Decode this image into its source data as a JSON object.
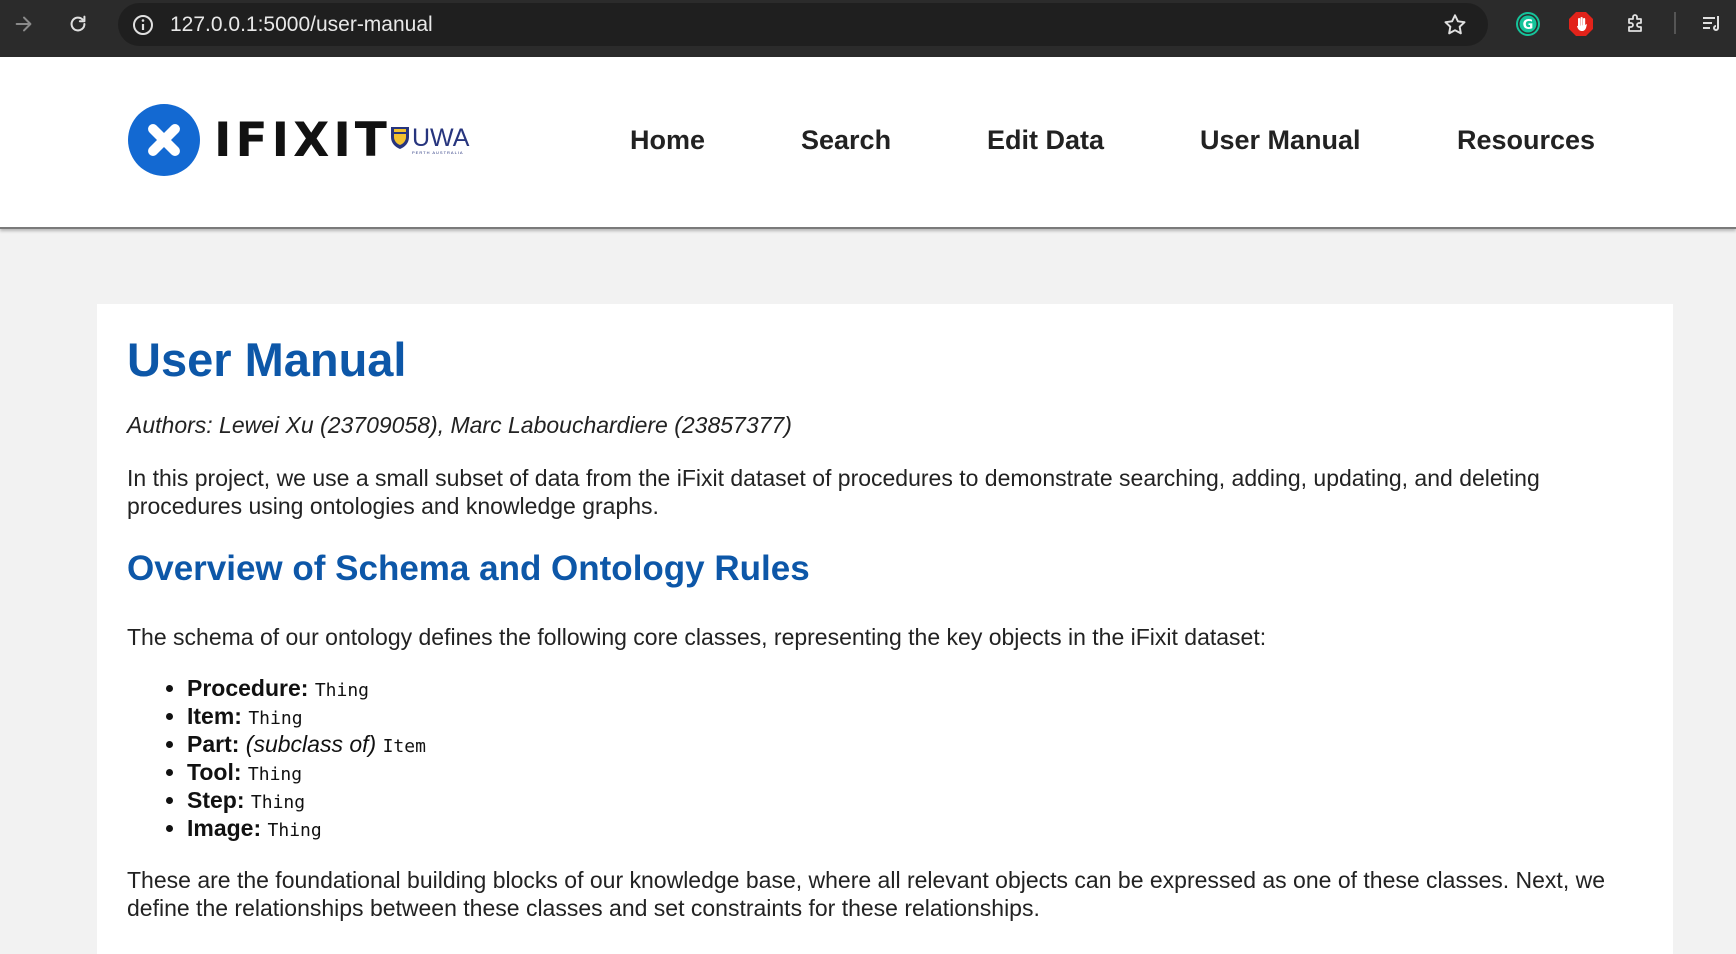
{
  "browser": {
    "url": "127.0.0.1:5000/user-manual"
  },
  "header": {
    "logo_text": "IFIXIT",
    "partner_logo_text": "UWA",
    "partner_logo_subtext": "PERTH AUSTRALIA",
    "nav": [
      {
        "label": "Home"
      },
      {
        "label": "Search"
      },
      {
        "label": "Edit Data"
      },
      {
        "label": "User Manual"
      },
      {
        "label": "Resources"
      }
    ]
  },
  "main": {
    "title": "User Manual",
    "authors": "Authors: Lewei Xu (23709058), Marc Labouchardiere (23857377)",
    "intro": "In this project, we use a small subset of data from the iFixit dataset of procedures to demonstrate searching, adding, updating, and deleting procedures using ontologies and knowledge graphs.",
    "section_title": "Overview of Schema and Ontology Rules",
    "schema_intro": "The schema of our ontology defines the following core classes, representing the key objects in the iFixit dataset:",
    "classes": [
      {
        "name": "Procedure:",
        "qualifier": "",
        "parent": "Thing"
      },
      {
        "name": "Item:",
        "qualifier": "",
        "parent": "Thing"
      },
      {
        "name": "Part:",
        "qualifier": "(subclass of)",
        "parent": "Item"
      },
      {
        "name": "Tool:",
        "qualifier": "",
        "parent": "Thing"
      },
      {
        "name": "Step:",
        "qualifier": "",
        "parent": "Thing"
      },
      {
        "name": "Image:",
        "qualifier": "",
        "parent": "Thing"
      }
    ],
    "outro": "These are the foundational building blocks of our knowledge base, where all relevant objects can be expressed as one of these classes. Next, we define the relationships between these classes and set constraints for these relationships."
  },
  "icons": {
    "back": "arrow-right-icon",
    "reload": "reload-icon",
    "site_info": "info-icon",
    "bookmark": "star-icon",
    "grammarly": "grammarly-icon",
    "adblock": "adblock-hand-icon",
    "extensions": "puzzle-icon",
    "reading_list": "reading-list-icon"
  },
  "colors": {
    "browser_bar": "#2b2b2b",
    "brand_blue": "#1369d2",
    "heading_blue": "#0d57a8",
    "page_bg": "#f2f2f2"
  }
}
